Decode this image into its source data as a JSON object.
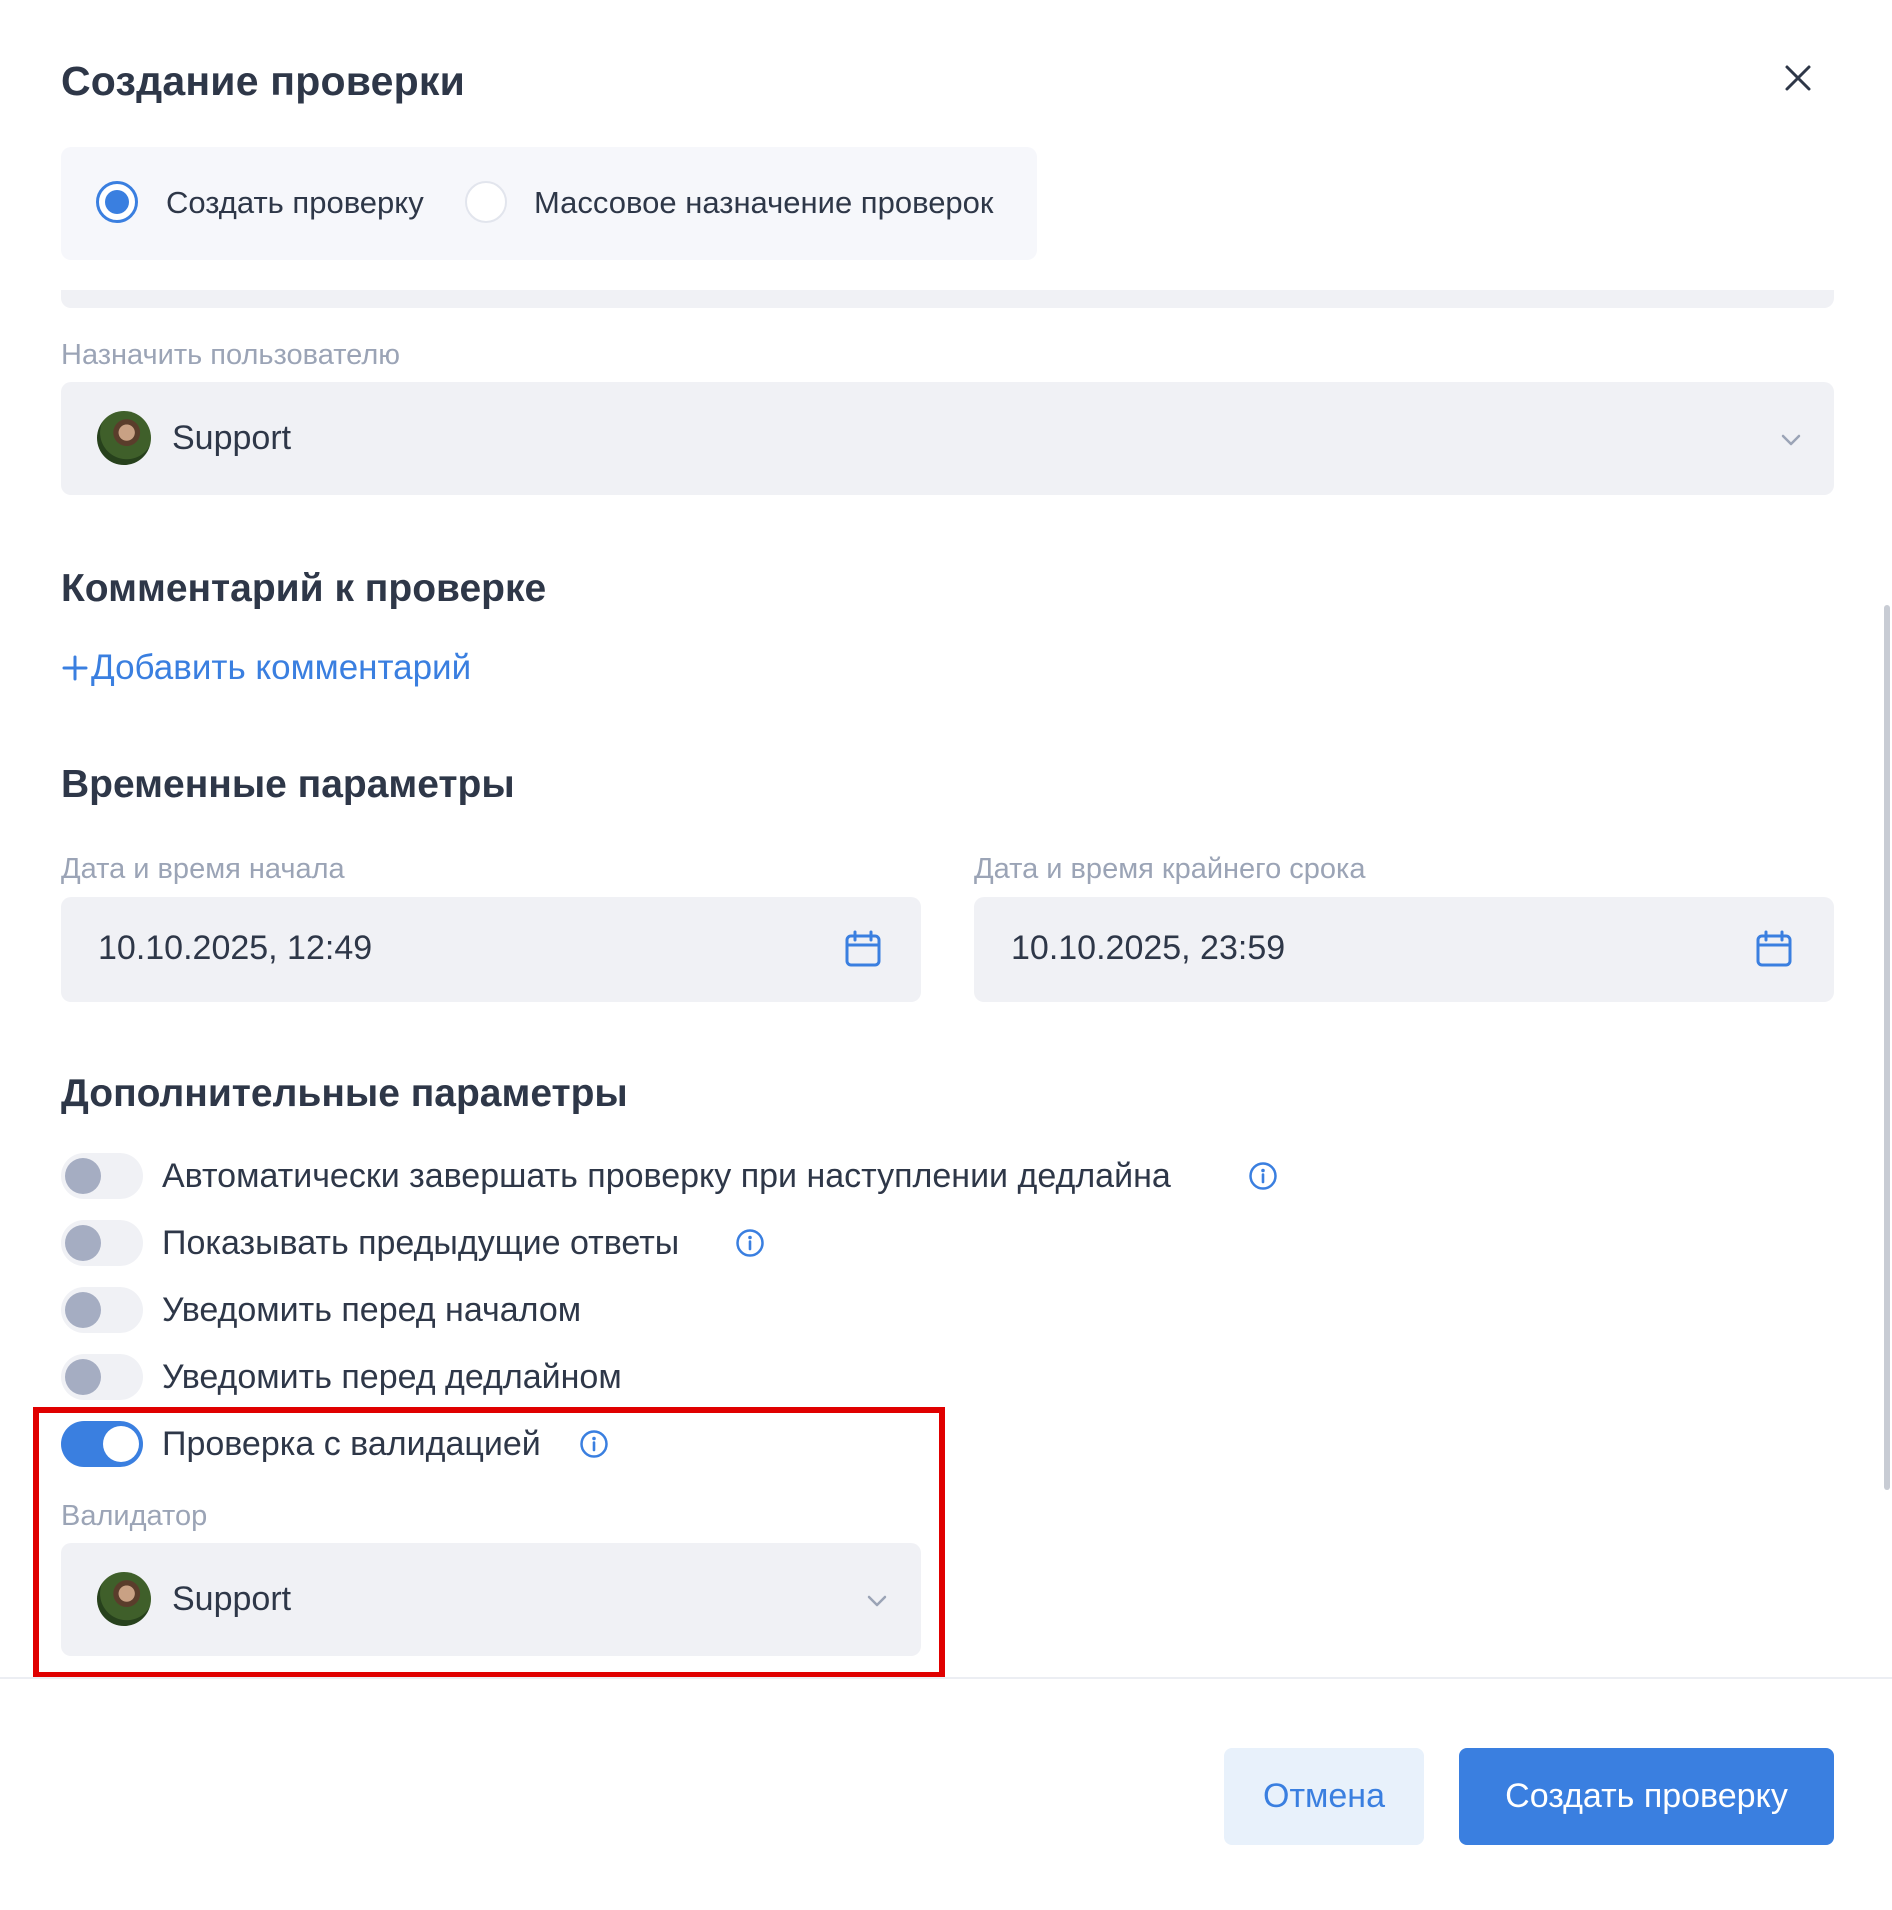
{
  "dialog": {
    "title": "Создание проверки",
    "close_icon": "close-icon"
  },
  "mode": {
    "options": [
      {
        "label": "Создать проверку",
        "selected": true
      },
      {
        "label": "Массовое назначение проверок",
        "selected": false
      }
    ]
  },
  "assignee": {
    "label": "Назначить пользователю",
    "value": "Support"
  },
  "comment": {
    "title": "Комментарий к проверке",
    "add_label": "Добавить комментарий"
  },
  "timing": {
    "title": "Временные параметры",
    "start_label": "Дата и время начала",
    "start_value": "10.10.2025, 12:49",
    "deadline_label": "Дата и время крайнего срока",
    "deadline_value": "10.10.2025, 23:59"
  },
  "extra": {
    "title": "Дополнительные параметры",
    "toggles": [
      {
        "label": "Автоматически завершать проверку при наступлении дедлайна",
        "on": false,
        "info": true
      },
      {
        "label": "Показывать предыдущие ответы",
        "on": false,
        "info": true
      },
      {
        "label": "Уведомить перед началом",
        "on": false,
        "info": false
      },
      {
        "label": "Уведомить перед дедлайном",
        "on": false,
        "info": false
      },
      {
        "label": "Проверка с валидацией",
        "on": true,
        "info": true
      }
    ],
    "validator_label": "Валидатор",
    "validator_value": "Support"
  },
  "footer": {
    "cancel_label": "Отмена",
    "submit_label": "Создать проверку"
  },
  "colors": {
    "accent": "#3a7fe0",
    "highlight": "#e00000"
  }
}
